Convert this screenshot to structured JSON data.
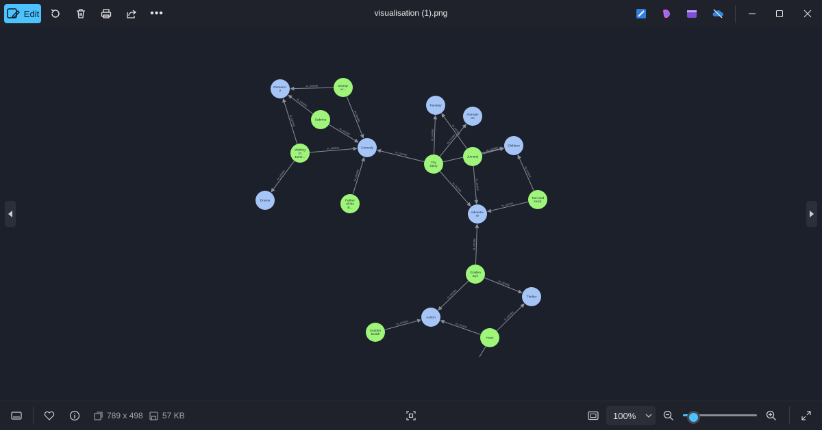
{
  "toolbar": {
    "edit_label": "Edit",
    "title": "visualisation (1).png"
  },
  "status": {
    "dimensions": "789 x 498",
    "file_size": "57 KB",
    "zoom": "100%",
    "zoom_fraction": 0.13
  },
  "graph": {
    "colors": {
      "genre": "#a6c5f7",
      "movie": "#9ef57a",
      "edge": "#8a8f9a",
      "text": "#1f2a3a"
    },
    "nodes": [
      {
        "id": "romance",
        "label": "Romanc-e",
        "type": "genre"
      },
      {
        "id": "grumpier",
        "label": "Grump-ie...",
        "type": "movie"
      },
      {
        "id": "sabrina",
        "label": "Sabrina",
        "type": "movie"
      },
      {
        "id": "comedy",
        "label": "Comedy",
        "type": "genre"
      },
      {
        "id": "waiting",
        "label": "Waiting to Exhe...",
        "type": "movie"
      },
      {
        "id": "drama",
        "label": "Drama",
        "type": "genre"
      },
      {
        "id": "father",
        "label": "Father of the B...",
        "type": "movie"
      },
      {
        "id": "fantasy",
        "label": "Fantasy",
        "type": "genre"
      },
      {
        "id": "animation",
        "label": "Animati-on",
        "type": "genre"
      },
      {
        "id": "children",
        "label": "Children",
        "type": "genre"
      },
      {
        "id": "toystory",
        "label": "Toy Story",
        "type": "movie"
      },
      {
        "id": "jumanji",
        "label": "Jumanji",
        "type": "movie"
      },
      {
        "id": "tomhuck",
        "label": "Tom and Huck",
        "type": "movie"
      },
      {
        "id": "adventure",
        "label": "Adventu-re",
        "type": "genre"
      },
      {
        "id": "goldeneye",
        "label": "Golden Eye",
        "type": "movie"
      },
      {
        "id": "thriller",
        "label": "Thriller",
        "type": "genre"
      },
      {
        "id": "action",
        "label": "Action",
        "type": "genre"
      },
      {
        "id": "suddendeath",
        "label": "Sudden Death",
        "type": "movie"
      },
      {
        "id": "heat",
        "label": "Heat",
        "type": "movie"
      }
    ],
    "edges": [
      {
        "from": "grumpier",
        "to": "romance",
        "label": "IN_GENRE"
      },
      {
        "from": "grumpier",
        "to": "comedy",
        "label": "IN_GENRE"
      },
      {
        "from": "sabrina",
        "to": "romance",
        "label": "IN_GENRE"
      },
      {
        "from": "sabrina",
        "to": "comedy",
        "label": "IN_GENRE"
      },
      {
        "from": "waiting",
        "to": "romance",
        "label": "IN_GENRE"
      },
      {
        "from": "waiting",
        "to": "comedy",
        "label": "IN_GENRE"
      },
      {
        "from": "waiting",
        "to": "drama",
        "label": "IN_GENRE"
      },
      {
        "from": "father",
        "to": "comedy",
        "label": "IN_GENRE"
      },
      {
        "from": "toystory",
        "to": "comedy",
        "label": "IN_GENRE"
      },
      {
        "from": "toystory",
        "to": "fantasy",
        "label": "IN_GENRE"
      },
      {
        "from": "toystory",
        "to": "animation",
        "label": "IN_GENRE"
      },
      {
        "from": "toystory",
        "to": "children",
        "label": "IN_GENRE"
      },
      {
        "from": "toystory",
        "to": "adventure",
        "label": "IN_GENRE"
      },
      {
        "from": "jumanji",
        "to": "fantasy",
        "label": "IN_GENRE"
      },
      {
        "from": "jumanji",
        "to": "children",
        "label": "IN_GENRE"
      },
      {
        "from": "jumanji",
        "to": "adventure",
        "label": "IN_GENRE"
      },
      {
        "from": "tomhuck",
        "to": "children",
        "label": "IN_GENRE"
      },
      {
        "from": "tomhuck",
        "to": "adventure",
        "label": "IN_GENRE"
      },
      {
        "from": "goldeneye",
        "to": "adventure",
        "label": "IN_GENRE"
      },
      {
        "from": "goldeneye",
        "to": "thriller",
        "label": "IN_GENRE"
      },
      {
        "from": "goldeneye",
        "to": "action",
        "label": "IN_GENRE"
      },
      {
        "from": "suddendeath",
        "to": "action",
        "label": "IN_GENRE"
      },
      {
        "from": "heat",
        "to": "action",
        "label": "IN_GENRE"
      },
      {
        "from": "heat",
        "to": "thriller",
        "label": "IN_GENRE"
      }
    ]
  }
}
